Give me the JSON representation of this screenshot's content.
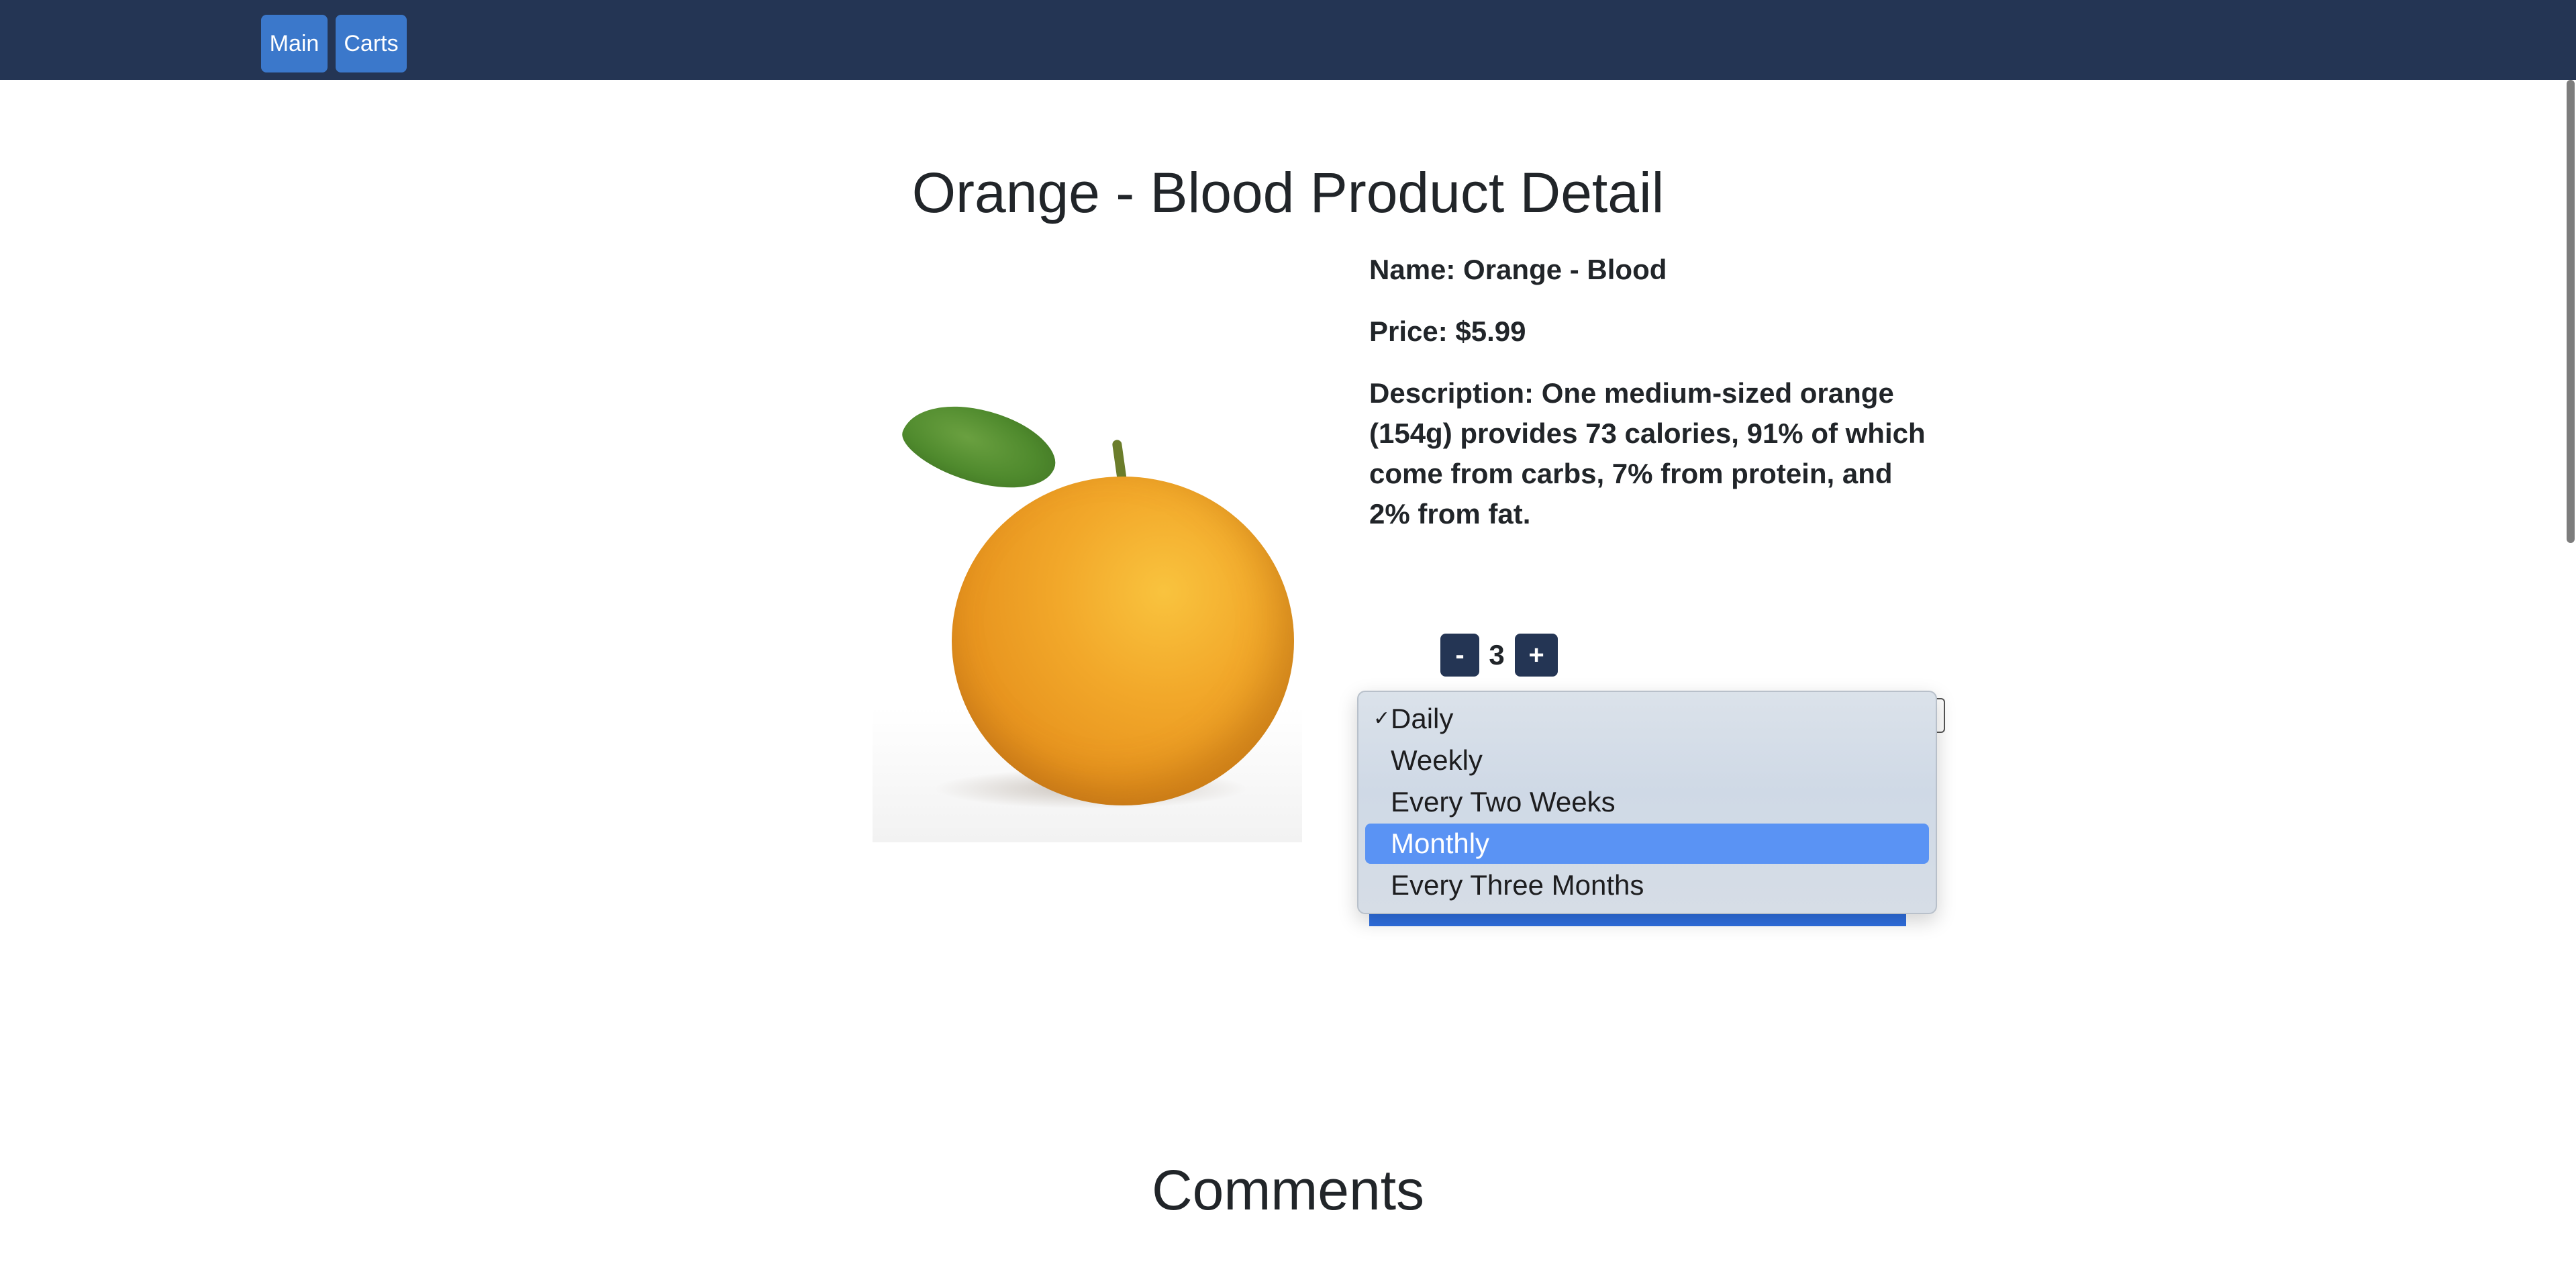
{
  "nav": {
    "main_label": "Main",
    "carts_label": "Carts"
  },
  "product": {
    "title": "Orange - Blood Product Detail",
    "name_line": "Name: Orange - Blood",
    "price_line": "Price: $5.99",
    "description_line": "Description: One medium-sized orange (154g) provides 73 calories, 91% of which come from carbs, 7% from protein, and 2% from fat."
  },
  "quantity": {
    "minus_label": "-",
    "value": "3",
    "plus_label": "+"
  },
  "frequency_dropdown": {
    "selected": "Daily",
    "highlighted": "Monthly",
    "check_glyph": "✓",
    "options": [
      "Daily",
      "Weekly",
      "Every Two Weeks",
      "Monthly",
      "Every Three Months"
    ]
  },
  "comments": {
    "title": "Comments"
  },
  "colors": {
    "navbar": "#243554",
    "nav_button": "#3b78cb",
    "highlight": "#5a93f4",
    "action_button": "#2f6fe0"
  }
}
